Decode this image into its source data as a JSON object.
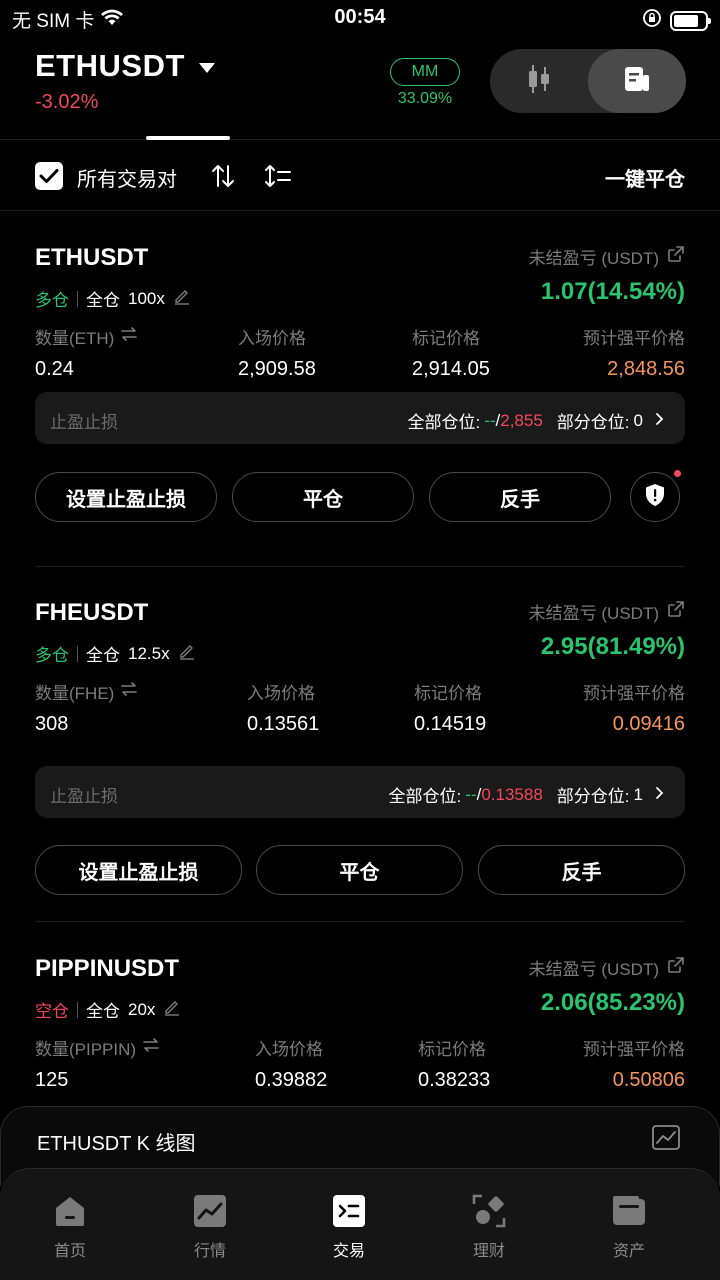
{
  "status_bar": {
    "carrier": "无 SIM 卡",
    "time": "00:54"
  },
  "header": {
    "pair": "ETHUSDT",
    "change": "-3.02%",
    "mm_label": "MM",
    "mm_value": "33.09%"
  },
  "toolbar": {
    "all_pairs_label": "所有交易对",
    "all_pairs_checked": true,
    "close_all_label": "一键平仓"
  },
  "positions": [
    {
      "symbol": "ETHUSDT",
      "side": "多仓",
      "margin_mode": "全仓",
      "leverage": "100x",
      "pnl_label": "未结盈亏 (USDT)",
      "pnl": "1.07(14.54%)",
      "qty_label": "数量(ETH)",
      "qty": "0.24",
      "entry_label": "入场价格",
      "entry": "2,909.58",
      "mark_label": "标记价格",
      "mark": "2,914.05",
      "liq_label": "预计强平价格",
      "liq": "2,848.56",
      "tpsl_label": "止盈止损",
      "tpsl_full_label": "全部仓位:",
      "tpsl_tp": "--",
      "tpsl_sep": "/",
      "tpsl_sl": "2,855",
      "tpsl_partial_label": "部分仓位:",
      "tpsl_partial_count": "0",
      "btn_set_tpsl": "设置止盈止损",
      "btn_close": "平仓",
      "btn_reverse": "反手"
    },
    {
      "symbol": "FHEUSDT",
      "side": "多仓",
      "margin_mode": "全仓",
      "leverage": "12.5x",
      "pnl_label": "未结盈亏 (USDT)",
      "pnl": "2.95(81.49%)",
      "qty_label": "数量(FHE)",
      "qty": "308",
      "entry_label": "入场价格",
      "entry": "0.13561",
      "mark_label": "标记价格",
      "mark": "0.14519",
      "liq_label": "预计强平价格",
      "liq": "0.09416",
      "tpsl_label": "止盈止损",
      "tpsl_full_label": "全部仓位:",
      "tpsl_tp": "--",
      "tpsl_sep": "/",
      "tpsl_sl": "0.13588",
      "tpsl_partial_label": "部分仓位:",
      "tpsl_partial_count": "1",
      "btn_set_tpsl": "设置止盈止损",
      "btn_close": "平仓",
      "btn_reverse": "反手"
    },
    {
      "symbol": "PIPPINUSDT",
      "side": "空仓",
      "margin_mode": "全仓",
      "leverage": "20x",
      "pnl_label": "未结盈亏 (USDT)",
      "pnl": "2.06(85.23%)",
      "qty_label": "数量(PIPPIN)",
      "qty": "125",
      "entry_label": "入场价格",
      "entry": "0.39882",
      "mark_label": "标记价格",
      "mark": "0.38233",
      "liq_label": "预计强平价格",
      "liq": "0.50806"
    }
  ],
  "kline_drawer": {
    "title": "ETHUSDT K 线图"
  },
  "bottom_nav": {
    "items": [
      {
        "label": "首页",
        "icon": "home-icon"
      },
      {
        "label": "行情",
        "icon": "market-chart-icon"
      },
      {
        "label": "交易",
        "icon": "trade-icon",
        "active": true
      },
      {
        "label": "理财",
        "icon": "earn-icon"
      },
      {
        "label": "资产",
        "icon": "wallet-icon"
      }
    ]
  },
  "colors": {
    "positive": "#2bc46e",
    "negative": "#f0495b",
    "liquidation": "#f6955c",
    "background": "#000000"
  }
}
